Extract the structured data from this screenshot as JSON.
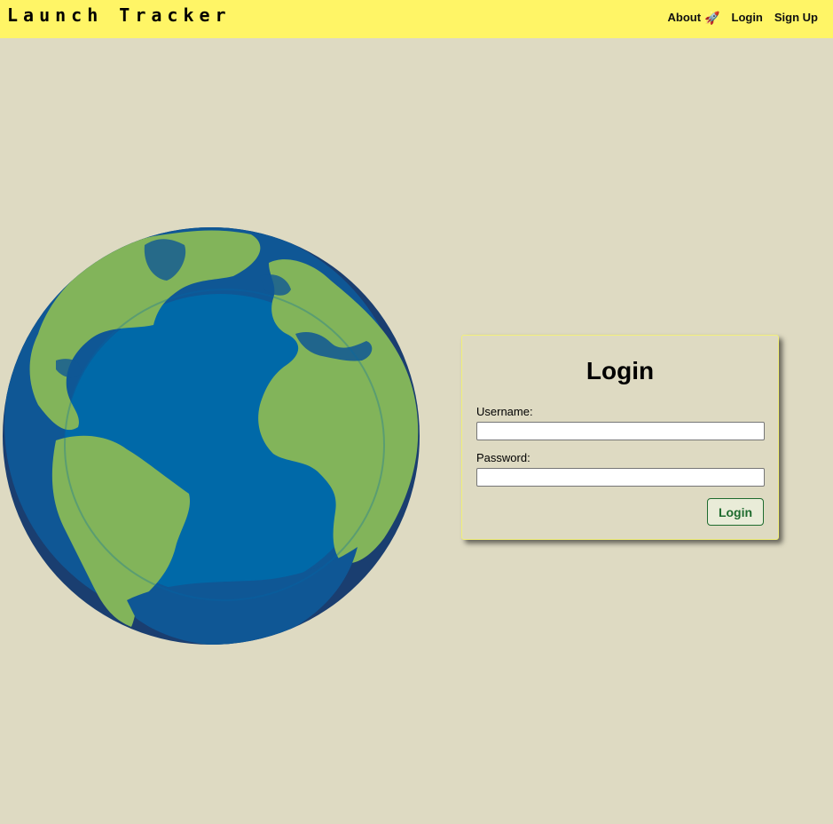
{
  "header": {
    "brand": "Launch Tracker",
    "nav": {
      "about_label": "About",
      "about_icon": "rocket-icon",
      "login_label": "Login",
      "signup_label": "Sign Up"
    }
  },
  "hero": {
    "image": "earth-globe-illustration"
  },
  "login_form": {
    "title": "Login",
    "username_label": "Username:",
    "username_value": "",
    "password_label": "Password:",
    "password_value": "",
    "submit_label": "Login"
  },
  "colors": {
    "header_bg": "#fff566",
    "page_bg": "#dedac2",
    "ocean": "#0069a8",
    "ocean_dark": "#1a3e70",
    "land": "#82b45a",
    "button_text": "#1e6b2e"
  }
}
